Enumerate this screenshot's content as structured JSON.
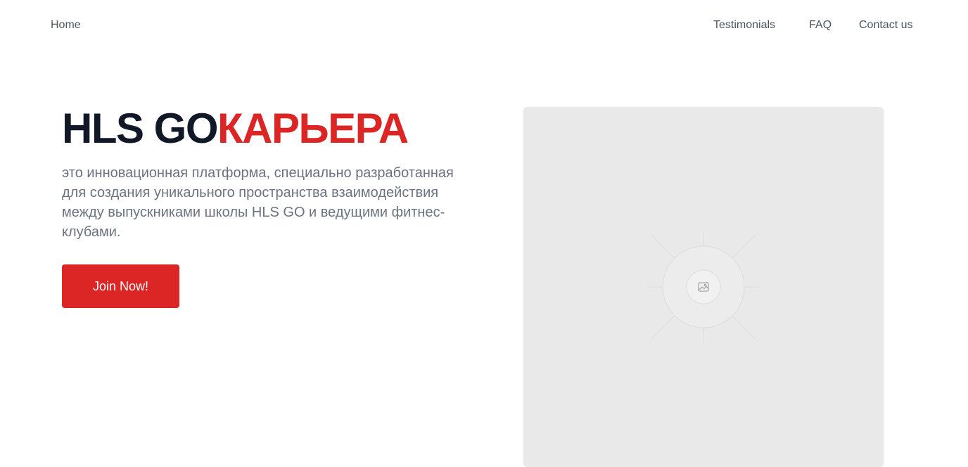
{
  "nav": {
    "home": "Home",
    "testimonials": "Testimonials",
    "faq": "FAQ",
    "contact": "Contact us"
  },
  "hero": {
    "title_brand": "HLS GO",
    "title_accent": "КАРЬЕРА",
    "description": "это инновационная платформа, специально разработанная для создания уникального пространства взаимодействия между выпускниками школы HLS GO и ведущими фитнес-клубами.",
    "cta_label": "Join Now!"
  },
  "media": {
    "icon": "image-placeholder-icon"
  },
  "colors": {
    "accent": "#dc2626",
    "heading": "#111827",
    "body_text": "#6b7280",
    "nav_text": "#4b5563",
    "placeholder_bg": "#e9e9e9"
  }
}
